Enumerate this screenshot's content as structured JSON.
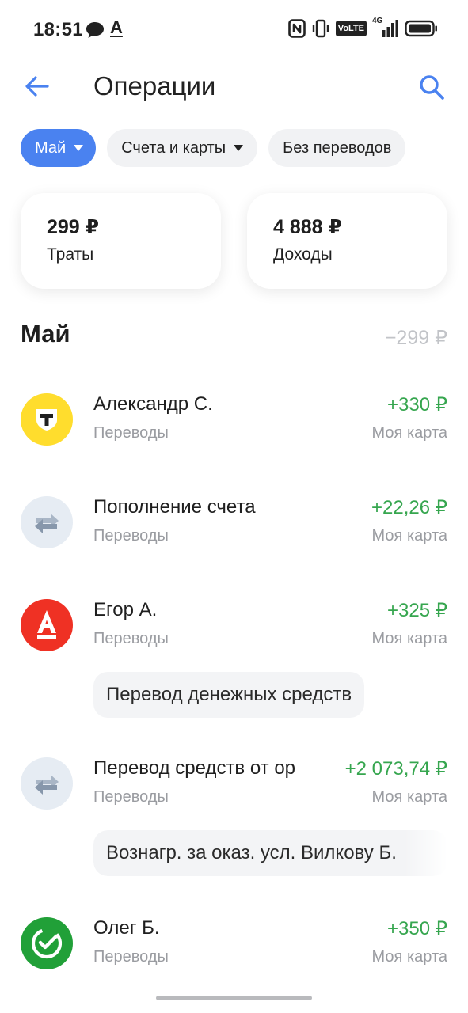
{
  "status_bar": {
    "time": "18:51",
    "letter_icon_text": "A",
    "network": "4G",
    "volte": "VoLTE",
    "icons": [
      "chat-bubble-icon",
      "nfc-icon",
      "vibrate-icon",
      "volte-icon",
      "signal-icon",
      "battery-icon"
    ]
  },
  "header": {
    "title": "Операции",
    "back_icon": "back-arrow-icon",
    "search_icon": "search-icon"
  },
  "filters": [
    {
      "label": "Май",
      "active": true,
      "dropdown": true
    },
    {
      "label": "Счета и карты",
      "active": false,
      "dropdown": true
    },
    {
      "label": "Без переводов",
      "active": false,
      "dropdown": false
    }
  ],
  "summary": {
    "spending": {
      "amount": "299 ₽",
      "label": "Траты"
    },
    "income": {
      "amount": "4 888 ₽",
      "label": "Доходы"
    }
  },
  "month": {
    "title": "Май",
    "total": "−299 ₽"
  },
  "operations": [
    {
      "name": "Александр С.",
      "category": "Переводы",
      "amount": "+330 ₽",
      "account": "Моя карта",
      "icon": "tinkoff-bank-icon",
      "note": ""
    },
    {
      "name": "Пополнение счета",
      "category": "Переводы",
      "amount": "+22,26 ₽",
      "account": "Моя карта",
      "icon": "transfer-arrows-icon",
      "note": ""
    },
    {
      "name": "Егор А.",
      "category": "Переводы",
      "amount": "+325 ₽",
      "account": "Моя карта",
      "icon": "alfa-bank-icon",
      "note": "Перевод денежных средств"
    },
    {
      "name": "Перевод средств от ор",
      "category": "Переводы",
      "amount": "+2 073,74 ₽",
      "account": "Моя карта",
      "icon": "transfer-arrows-icon",
      "note": "Вознагр. за оказ. усл. Вилкову Б."
    },
    {
      "name": "Олег Б.",
      "category": "Переводы",
      "amount": "+350 ₽",
      "account": "Моя карта",
      "icon": "sberbank-icon",
      "note": ""
    }
  ],
  "colors": {
    "accent": "#4a82f0",
    "income": "#36a64f",
    "muted": "#9a9ca1",
    "chip_bg": "#f1f2f4",
    "tinkoff_yellow": "#ffdd2d",
    "alfa_red": "#ef3124",
    "sber_green": "#21a038",
    "transfer_bg": "#e6ecf3"
  }
}
